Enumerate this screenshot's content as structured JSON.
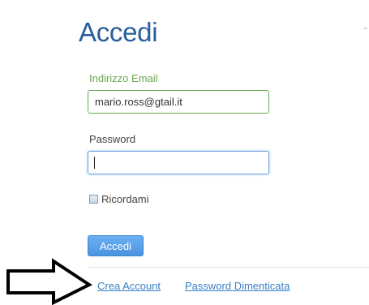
{
  "login": {
    "title": "Accedi",
    "email_label": "Indirizzo Email",
    "email_value": "mario.ross@gtail.it",
    "password_label": "Password",
    "password_value": "",
    "remember_label": "Ricordami",
    "remember_checked": false,
    "submit_label": "Accedi"
  },
  "links": {
    "create_account": "Crea Account",
    "forgot_password": "Password Dimenticata"
  },
  "annotation": {
    "icon": "arrow-right-icon",
    "color": "#000000"
  },
  "colors": {
    "title": "#2b5e9c",
    "email_accent": "#6aa84f",
    "focus_blue": "#6fa4e0",
    "button": "#4a93e0",
    "link": "#3a7fc8"
  }
}
